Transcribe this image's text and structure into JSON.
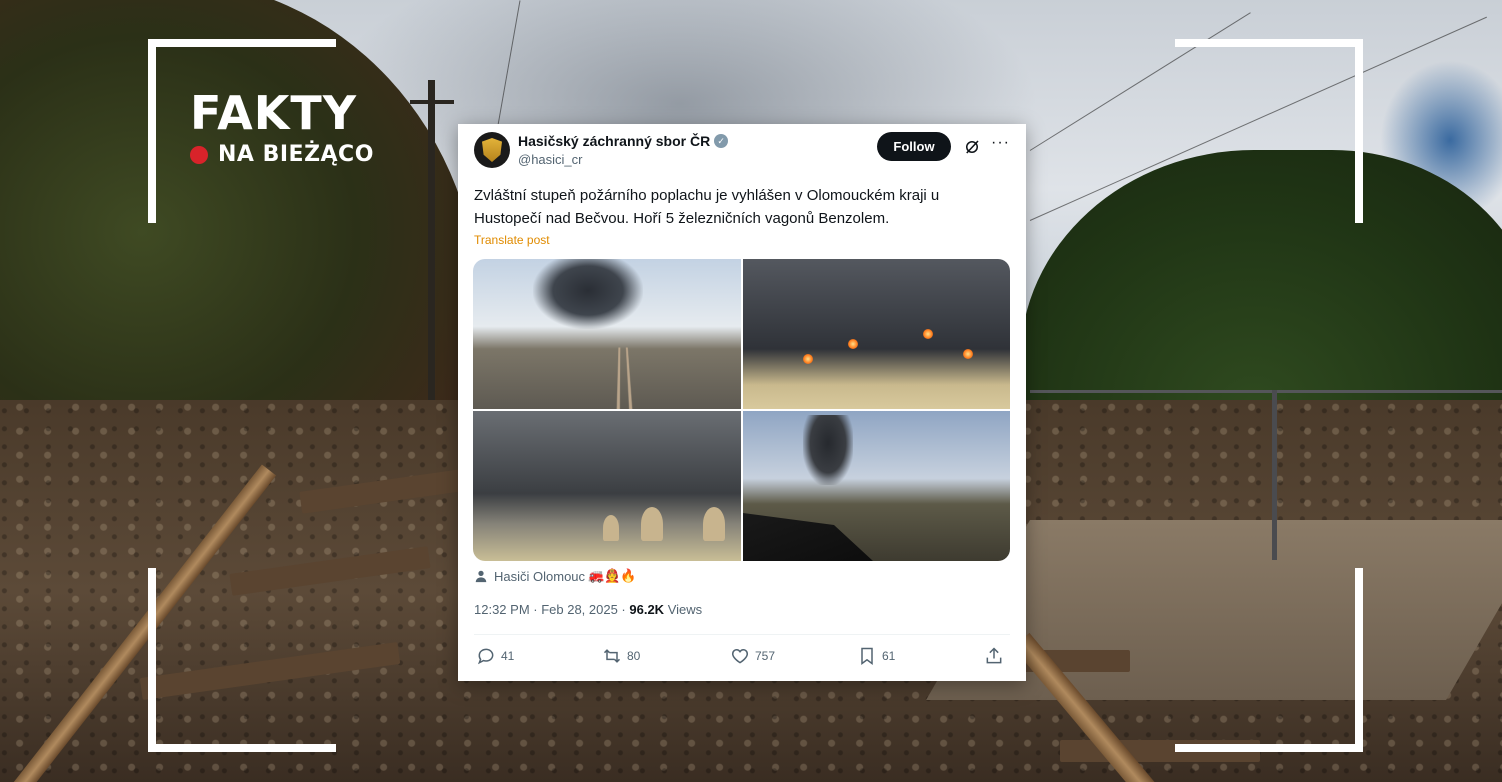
{
  "brand": {
    "title": "FAKTY",
    "subtitle": "NA BIEŻĄCO",
    "live_dot_color": "#d8232a"
  },
  "tweet": {
    "display_name": "Hasičský záchranný sbor ČR",
    "verified_icon": "verified-badge-icon",
    "handle": "@hasici_cr",
    "follow_label": "Follow",
    "more_label": "···",
    "text_line1": "Zvláštní stupeň požárního poplachu je vyhlášen v Olomouckém kraji u",
    "text_line2": "Hustopečí nad Bečvou. Hoří 5 železničních vagonů Benzolem.",
    "translate_label": "Translate post",
    "location": "Hasiči Olomouc",
    "location_emoji": "🚒🧑‍🚒🔥",
    "time": "12:32 PM · Feb 28, 2025 · ",
    "views_count": "96.2K",
    "views_label": " Views",
    "actions": {
      "replies": "41",
      "reposts": "80",
      "likes": "757",
      "bookmarks": "61"
    },
    "accent_color": "#e08b00"
  }
}
